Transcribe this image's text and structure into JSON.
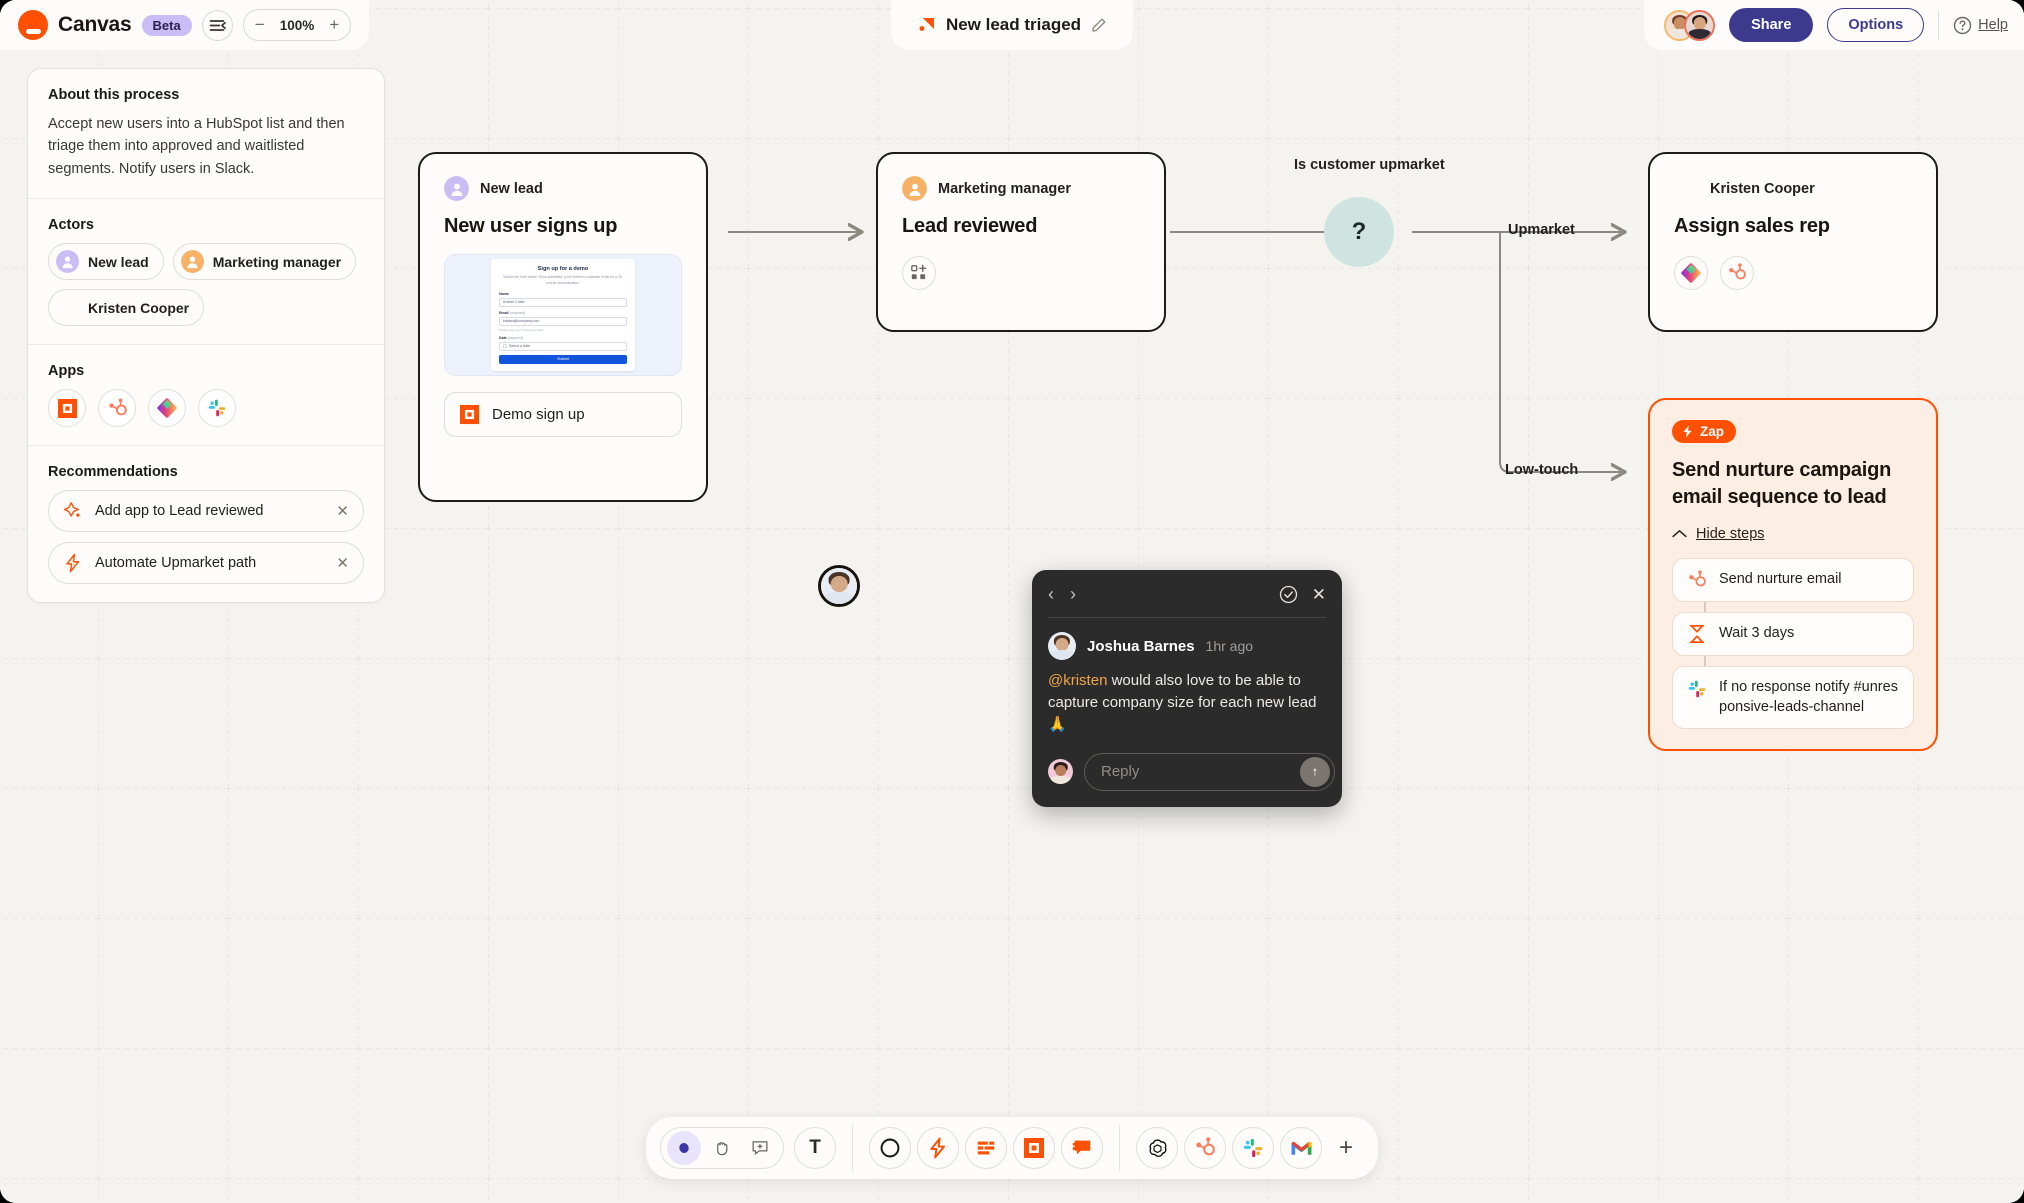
{
  "header": {
    "brand": "Canvas",
    "beta_badge": "Beta",
    "zoom_level": "100%",
    "zoom_out": "−",
    "zoom_in": "+",
    "doc_title": "New lead triaged",
    "share_label": "Share",
    "options_label": "Options",
    "help_label": "Help"
  },
  "sidebar": {
    "about_title": "About this process",
    "about_text": "Accept new users into a HubSpot list and then triage them into approved and waitlisted segments. Notify users in Slack.",
    "actors_title": "Actors",
    "actors": [
      {
        "name": "New lead",
        "avatar_type": "purple-user"
      },
      {
        "name": "Marketing manager",
        "avatar_type": "orange-user"
      },
      {
        "name": "Kristen Cooper",
        "avatar_type": "photo-kristen"
      }
    ],
    "apps_title": "Apps",
    "apps": [
      "interfaces-icon",
      "hubspot-icon",
      "tables-icon",
      "slack-icon"
    ],
    "recommendations_title": "Recommendations",
    "recommendations": [
      {
        "label": "Add app to Lead reviewed",
        "icon": "sparkle-icon",
        "close": "✕"
      },
      {
        "label": "Automate Upmarket path",
        "icon": "bolt-icon",
        "close": "✕"
      }
    ]
  },
  "canvas": {
    "nodes": [
      {
        "id": "new-user-signs-up",
        "actor": "New lead",
        "actor_avatar": "purple-user",
        "title": "New user signs up",
        "app_pill": "Demo sign up",
        "app_icon": "interfaces-icon",
        "preview": {
          "title": "Sign up for a demo",
          "subtitle": "Submit the form below. Once submitted, you'll receive a calendar invite for a 30-minute demonstration.",
          "fields": [
            {
              "label": "Name",
              "required": "",
              "value": "Kristen Cutler"
            },
            {
              "label": "Email",
              "required": "(required)",
              "value": "kristen@company.com",
              "hint": "Please use your business email"
            },
            {
              "label": "Date",
              "required": "(required)",
              "value": "Select a date"
            }
          ],
          "submit": "Submit"
        }
      },
      {
        "id": "lead-reviewed",
        "actor": "Marketing manager",
        "actor_avatar": "orange-user",
        "title": "Lead reviewed",
        "add_app_icon": "add-app-icon"
      },
      {
        "id": "assign-sales-rep",
        "actor": "Kristen Cooper",
        "actor_avatar": "photo-kristen",
        "title": "Assign sales rep",
        "apps": [
          "tables-icon",
          "hubspot-icon"
        ]
      }
    ],
    "decision": {
      "label": "Is customer upmarket",
      "symbol": "?",
      "branches": [
        {
          "label": "Upmarket"
        },
        {
          "label": "Low-touch"
        }
      ]
    },
    "zap_card": {
      "badge": "Zap",
      "title": "Send nurture campaign email sequence to lead",
      "toggle_label": "Hide steps",
      "steps": [
        {
          "label": "Send nurture email",
          "icon": "hubspot-icon"
        },
        {
          "label": "Wait 3 days",
          "icon": "delay-icon"
        },
        {
          "label": "If no response notify #unresponsive-leads-channel",
          "icon": "slack-icon"
        }
      ]
    },
    "comment": {
      "author": "Joshua Barnes",
      "time": "1hr ago",
      "mention": "@kristen",
      "body": " would also love to be able to capture company size for each new lead 🙏",
      "reply_placeholder": "Reply",
      "prev": "‹",
      "next": "›",
      "resolve": "resolve-icon",
      "close": "✕",
      "send": "↑"
    }
  },
  "toolbar": {
    "tools": [
      {
        "name": "select-tool",
        "icon": "cursor-icon",
        "selected": true
      },
      {
        "name": "hand-tool",
        "icon": "hand-icon",
        "selected": false
      },
      {
        "name": "comment-tool",
        "icon": "comment-add-icon",
        "selected": false
      }
    ],
    "text_tool": "T",
    "shapes": [
      {
        "name": "shape-tool",
        "icon": "circle-icon"
      },
      {
        "name": "zap-tool",
        "icon": "bolt-icon"
      },
      {
        "name": "table-tool",
        "icon": "tables-bars-icon"
      },
      {
        "name": "interfaces-tool",
        "icon": "interfaces-icon"
      },
      {
        "name": "chatbot-tool",
        "icon": "chatbot-icon"
      }
    ],
    "apps": [
      {
        "name": "openai-app",
        "icon": "openai-icon"
      },
      {
        "name": "hubspot-app",
        "icon": "hubspot-icon"
      },
      {
        "name": "slack-app",
        "icon": "slack-icon"
      },
      {
        "name": "gmail-app",
        "icon": "gmail-icon"
      }
    ],
    "add_label": "+"
  },
  "colors": {
    "accent_orange": "#ff4f00",
    "share_indigo": "#3d3a8e",
    "beta_purple": "#c9bdf5",
    "decision_teal": "#cfe4e0",
    "canvas_bg": "#f4f3ef",
    "panel_bg": "#fdfcfa",
    "node_border": "#1e1a16",
    "comment_bg": "#2b2b2b",
    "mention_gold": "#f0a64a"
  }
}
